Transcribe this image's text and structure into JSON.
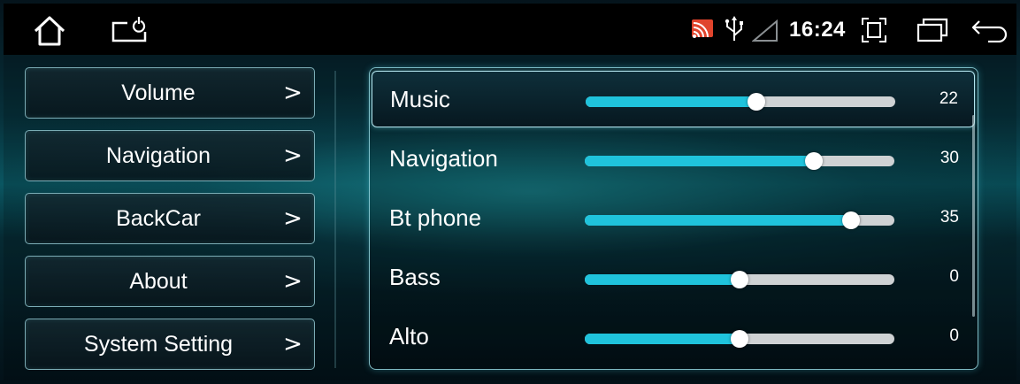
{
  "status_bar": {
    "time": "16:24",
    "icons": [
      "home-icon",
      "power-icon",
      "cast-icon",
      "usb-icon",
      "signal-icon",
      "screenshot-icon",
      "recents-icon",
      "back-icon"
    ]
  },
  "menu": [
    {
      "label": "Volume",
      "chevron": ">"
    },
    {
      "label": "Navigation",
      "chevron": ">"
    },
    {
      "label": "BackCar",
      "chevron": ">"
    },
    {
      "label": "About",
      "chevron": ">"
    },
    {
      "label": "System Setting",
      "chevron": ">"
    }
  ],
  "sliders": [
    {
      "label": "Music",
      "value": "22",
      "level": 0.55,
      "selected": true
    },
    {
      "label": "Navigation",
      "value": "30",
      "level": 0.74,
      "selected": false
    },
    {
      "label": "Bt phone",
      "value": "35",
      "level": 0.86,
      "selected": false
    },
    {
      "label": "Bass",
      "value": "0",
      "level": 0.5,
      "selected": false
    },
    {
      "label": "Alto",
      "value": "0",
      "level": 0.5,
      "selected": false
    }
  ],
  "colors": {
    "accent": "#1fc3dc",
    "track": "#cfd2d4",
    "border": "#a0e0e6"
  }
}
